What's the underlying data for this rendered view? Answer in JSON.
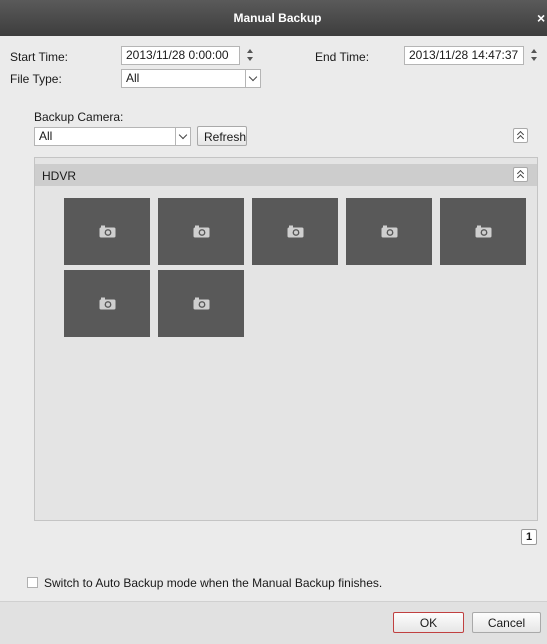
{
  "window": {
    "title": "Manual Backup",
    "close_glyph": "×"
  },
  "time": {
    "start_label": "Start Time:",
    "start_value": "2013/11/28 0:00:00",
    "end_label": "End Time:",
    "end_value": "2013/11/28 14:47:37"
  },
  "file_type": {
    "label": "File Type:",
    "selected": "All"
  },
  "camera": {
    "label": "Backup Camera:",
    "selected": "All",
    "refresh_label": "Refresh"
  },
  "group": {
    "name": "HDVR",
    "tiles": [
      {
        "icon": "camera-icon"
      },
      {
        "icon": "camera-icon"
      },
      {
        "icon": "camera-icon"
      },
      {
        "icon": "camera-icon"
      },
      {
        "icon": "camera-icon"
      },
      {
        "icon": "camera-icon"
      },
      {
        "icon": "camera-icon"
      }
    ]
  },
  "pagination": {
    "current_page": "1"
  },
  "auto_backup": {
    "label": "Switch to Auto Backup mode when the Manual Backup finishes.",
    "checked": false
  },
  "actions": {
    "ok_label": "OK",
    "cancel_label": "Cancel"
  },
  "colors": {
    "titlebar": "#4a4a4a",
    "tile": "#595959",
    "ok_border": "#c04040"
  }
}
